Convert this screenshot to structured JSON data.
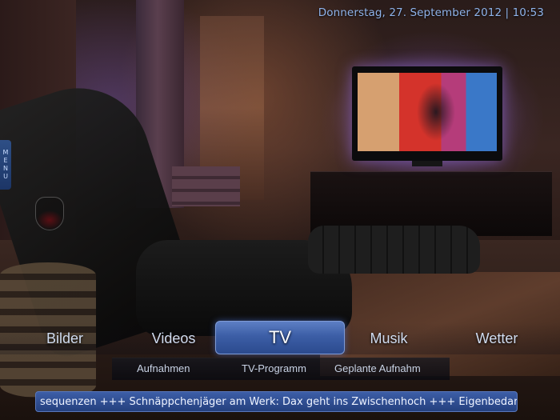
{
  "header": {
    "datetime": "Donnerstag, 27. September 2012 | 10:53"
  },
  "side_menu": {
    "letters": [
      "M",
      "E",
      "N",
      "U"
    ]
  },
  "main_nav": {
    "items": [
      {
        "label": "Bilder",
        "active": false
      },
      {
        "label": "Videos",
        "active": false
      },
      {
        "label": "TV",
        "active": true
      },
      {
        "label": "Musik",
        "active": false
      },
      {
        "label": "Wetter",
        "active": false
      }
    ]
  },
  "sub_nav": {
    "items": [
      {
        "label": "Aufnahmen"
      },
      {
        "label": "TV-Programm"
      },
      {
        "label": "Geplante Aufnahm"
      }
    ]
  },
  "ticker": {
    "text": "sequenzen +++ Schnäppchenjäger am Werk: Dax geht ins Zwischenhoch +++ Eigenbedarf fü"
  },
  "colors": {
    "accent": "#3c5ea6",
    "date_text": "#8fb3ea"
  }
}
